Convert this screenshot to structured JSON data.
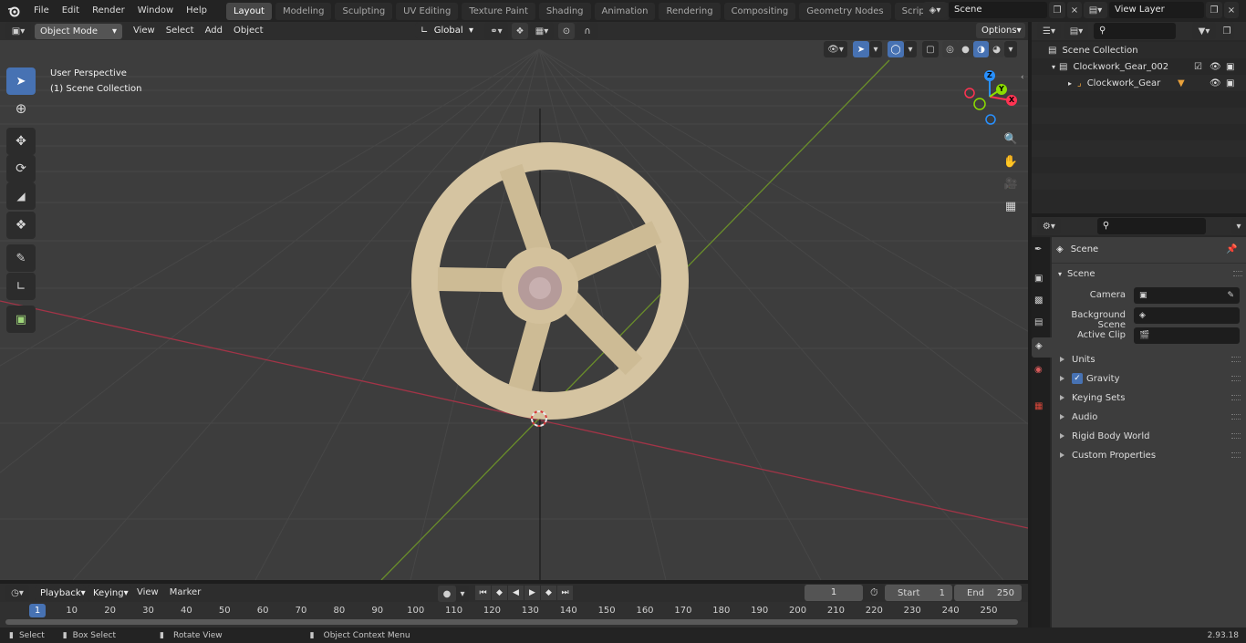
{
  "topbar": {
    "menus": [
      "File",
      "Edit",
      "Render",
      "Window",
      "Help"
    ],
    "workspace_tabs": [
      "Layout",
      "Modeling",
      "Sculpting",
      "UV Editing",
      "Texture Paint",
      "Shading",
      "Animation",
      "Rendering",
      "Compositing",
      "Geometry Nodes",
      "Scripting"
    ],
    "active_tab": "Layout",
    "scene_name": "Scene",
    "view_layer": "View Layer"
  },
  "viewport_header": {
    "mode": "Object Mode",
    "menus": [
      "View",
      "Select",
      "Add",
      "Object"
    ],
    "transform_orientation": "Global",
    "options_label": "Options"
  },
  "viewport": {
    "perspective_label": "User Perspective",
    "collection_label": "(1) Scene Collection",
    "gizmo_labels": {
      "x": "X",
      "y": "Y",
      "z": "Z"
    },
    "colors": {
      "x_axis": "#ff3352",
      "y_axis": "#8bdc00",
      "z_axis": "#2890ff",
      "gear": "#d5c4a1",
      "background": "#3d3d3d"
    }
  },
  "outliner": {
    "root": "Scene Collection",
    "collection": "Clockwork_Gear_002",
    "object": "Clockwork_Gear"
  },
  "properties": {
    "context_title": "Scene",
    "section": "Scene",
    "fields": [
      {
        "label": "Camera",
        "value": ""
      },
      {
        "label": "Background Scene",
        "value": ""
      },
      {
        "label": "Active Clip",
        "value": ""
      }
    ],
    "panels": [
      "Units",
      "Gravity",
      "Keying Sets",
      "Audio",
      "Rigid Body World",
      "Custom Properties"
    ],
    "gravity_checked": true
  },
  "timeline": {
    "menus": [
      "Playback",
      "Keying",
      "View",
      "Marker"
    ],
    "current_frame": "1",
    "start_label": "Start",
    "start_value": "1",
    "end_label": "End",
    "end_value": "250",
    "ticks": [
      "1",
      "10",
      "20",
      "30",
      "40",
      "50",
      "60",
      "70",
      "80",
      "90",
      "100",
      "110",
      "120",
      "130",
      "140",
      "150",
      "160",
      "170",
      "180",
      "190",
      "200",
      "210",
      "220",
      "230",
      "240",
      "250"
    ]
  },
  "statusbar": {
    "items": [
      "Select",
      "Box Select",
      "Rotate View",
      "Object Context Menu"
    ],
    "version": "2.93.18"
  }
}
